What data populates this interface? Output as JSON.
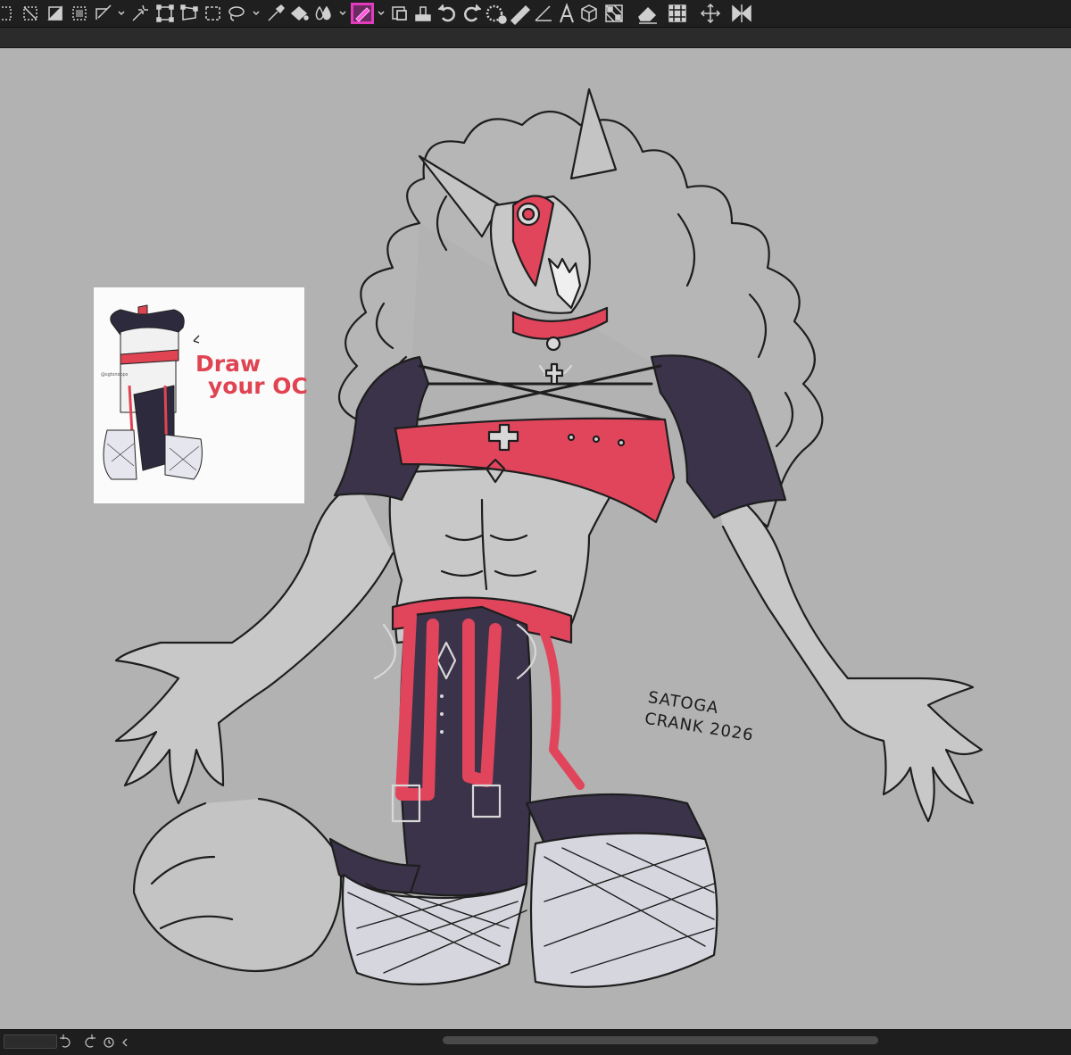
{
  "toolbar": {
    "tools": [
      {
        "name": "select-all-icon",
        "interactable": true
      },
      {
        "name": "deselect-icon",
        "interactable": true
      },
      {
        "name": "invert-selection-icon",
        "interactable": true
      },
      {
        "name": "rectangle-marquee-icon",
        "interactable": true
      },
      {
        "name": "selection-edit-icon",
        "interactable": true
      },
      {
        "name": "magic-wand-icon",
        "interactable": true
      },
      {
        "name": "free-transform-icon",
        "interactable": true
      },
      {
        "name": "perspective-transform-icon",
        "interactable": true
      },
      {
        "name": "rectangle-select-icon",
        "interactable": true
      },
      {
        "name": "lasso-select-icon",
        "interactable": true
      },
      {
        "name": "eyedropper-icon",
        "interactable": true
      },
      {
        "name": "fill-bucket-icon",
        "interactable": true
      },
      {
        "name": "gradient-drop-icon",
        "interactable": true
      },
      {
        "name": "pen-brush-icon",
        "interactable": true,
        "active": true
      },
      {
        "name": "layer-selection-icon",
        "interactable": true
      },
      {
        "name": "stamp-icon",
        "interactable": true
      },
      {
        "name": "rotate-left-icon",
        "interactable": true
      },
      {
        "name": "rotate-right-icon",
        "interactable": true
      },
      {
        "name": "rotation-reset-icon",
        "interactable": true
      },
      {
        "name": "ruler-icon",
        "interactable": true
      },
      {
        "name": "perspective-ruler-icon",
        "interactable": true
      },
      {
        "name": "text-tool-icon",
        "interactable": true
      },
      {
        "name": "3d-cube-icon",
        "interactable": true
      },
      {
        "name": "checker-grid-icon",
        "interactable": true
      },
      {
        "name": "eraser-icon",
        "interactable": true
      },
      {
        "name": "transform-grid-icon",
        "interactable": true
      },
      {
        "name": "move-arrows-icon",
        "interactable": true
      },
      {
        "name": "flip-horizontal-icon",
        "interactable": true
      }
    ],
    "active_color": "#e23cbc"
  },
  "reference_card": {
    "title_line1": "Draw",
    "title_line2": "your OC",
    "handle": "@sgtsnoops",
    "accent_color": "#e04452"
  },
  "signature": {
    "line1": "SATOGA",
    "line2": "CRANK 2026"
  },
  "colors": {
    "canvas_bg": "#b2b2b2",
    "toolbar_bg": "#1f1f1f",
    "outfit_red": "#e0455c",
    "outfit_navy": "#3a3349",
    "fishnet": "#d6d6de"
  },
  "statusbar": {
    "icons": [
      "undo-icon",
      "redo-icon",
      "history-icon",
      "collapse-left-icon"
    ]
  }
}
